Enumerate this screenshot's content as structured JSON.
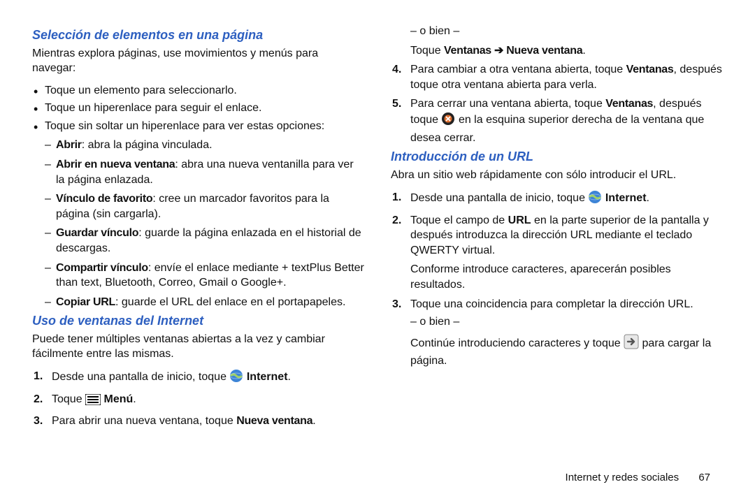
{
  "sections": {
    "sel": {
      "heading": "Selección de elementos en una página",
      "intro": "Mientras explora páginas, use movimientos y menús para navegar:",
      "bullets": [
        "Toque un elemento para seleccionarlo.",
        "Toque un hiperenlace para seguir el enlace.",
        "Toque sin soltar un hiperenlace para ver estas opciones:"
      ],
      "options": [
        {
          "label": "Abrir",
          "rest": ": abra la página vinculada."
        },
        {
          "label": "Abrir en nueva ventana",
          "rest": ": abra una nueva ventanilla para ver la página enlazada."
        },
        {
          "label": "Vínculo de favorito",
          "rest": ": cree un marcador favoritos para la página (sin cargarla)."
        },
        {
          "label": "Guardar vínculo",
          "rest": ": guarde la página enlazada en el historial de descargas."
        },
        {
          "label": "Compartir vínculo",
          "rest": ": envíe el enlace mediante + textPlus Better than text, Bluetooth, Correo, Gmail o Google+."
        },
        {
          "label": "Copiar URL",
          "rest": ": guarde el URL del enlace en el portapapeles."
        }
      ]
    },
    "win": {
      "heading": "Uso de ventanas del Internet",
      "intro": "Puede tener múltiples ventanas abiertas a la vez y cambiar fácilmente entre las mismas.",
      "steps12": [
        {
          "pre": "Desde una pantalla de inicio, toque ",
          "icon": "internet",
          "post_bold": "Internet",
          "post": "."
        },
        {
          "pre": "Toque ",
          "icon": "menu",
          "post_bold": "Menú",
          "post": "."
        }
      ],
      "step3": {
        "pre": "Para abrir una nueva ventana, toque ",
        "bold": "Nueva ventana",
        "post": ".",
        "or": "– o bien –",
        "alt_pre": "Toque ",
        "alt_bold": "Ventanas ➔ Nueva ventana",
        "alt_post": "."
      },
      "step4": {
        "pre": "Para cambiar a otra ventana abierta, toque ",
        "bold": "Ventanas",
        "post": ", después toque otra ventana abierta para verla."
      },
      "step5": {
        "pre": "Para cerrar una ventana abierta, toque ",
        "bold": "Ventanas",
        "mid": ", después toque ",
        "icon": "close",
        "tail": " en la esquina superior derecha de la ventana que desea cerrar."
      }
    },
    "url": {
      "heading": "Introducción de un URL",
      "intro": "Abra un sitio web rápidamente con sólo introducir el URL.",
      "steps": {
        "s1": {
          "pre": "Desde una pantalla de inicio, toque ",
          "icon": "internet",
          "post_bold": "Internet",
          "post": "."
        },
        "s2": {
          "pre": "Toque el campo de ",
          "bold": "URL",
          "post": " en la parte superior de la pantalla y después introduzca la dirección URL mediante el teclado QWERTY virtual."
        },
        "s2_note": "Conforme introduce caracteres, aparecerán posibles resultados.",
        "s3": {
          "text": "Toque una coincidencia para completar la dirección URL.",
          "or": "– o bien –"
        },
        "s3_alt": {
          "pre": "Continúe introduciendo caracteres y toque ",
          "icon": "go",
          "post": " para cargar la página."
        }
      }
    }
  },
  "footer": {
    "chapter": "Internet y redes sociales",
    "page": "67"
  }
}
